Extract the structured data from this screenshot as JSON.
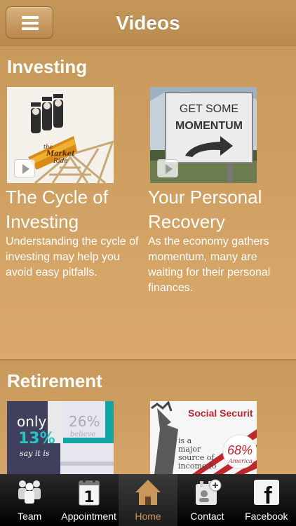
{
  "header": {
    "title": "Videos",
    "menu_icon": "hamburger-menu-icon"
  },
  "sections": [
    {
      "title": "Investing",
      "items": [
        {
          "title": "The Cycle of Investing",
          "description": "Understanding the cycle of investing may help you avoid easy pitfalls.",
          "thumbnail_text": [
            "the",
            "Market",
            "Ride"
          ]
        },
        {
          "title": "Your Personal Recovery",
          "description": "As the economy gathers momentum, many are waiting for their personal finances.",
          "thumbnail_text": [
            "GET SOME",
            "MOMENTUM"
          ]
        }
      ]
    },
    {
      "title": "Retirement",
      "items": [
        {
          "thumbnail_text": [
            "only",
            "13%",
            "say it is",
            "26%",
            "believe"
          ]
        },
        {
          "thumbnail_text": [
            "Social Securit",
            "is a",
            "major",
            "source of",
            "income fo",
            "68%",
            "America"
          ]
        }
      ]
    }
  ],
  "tabbar": {
    "active": "Home",
    "tabs": [
      {
        "label": "Team",
        "icon": "team-icon"
      },
      {
        "label": "Appointment",
        "icon": "calendar-icon",
        "icon_text": "1"
      },
      {
        "label": "Home",
        "icon": "home-icon"
      },
      {
        "label": "Contact",
        "icon": "contact-icon"
      },
      {
        "label": "Facebook",
        "icon": "facebook-icon",
        "icon_text": "f"
      }
    ]
  },
  "colors": {
    "background": "#c59a5d",
    "accent": "#c8975a",
    "tabbar": "#000000"
  }
}
